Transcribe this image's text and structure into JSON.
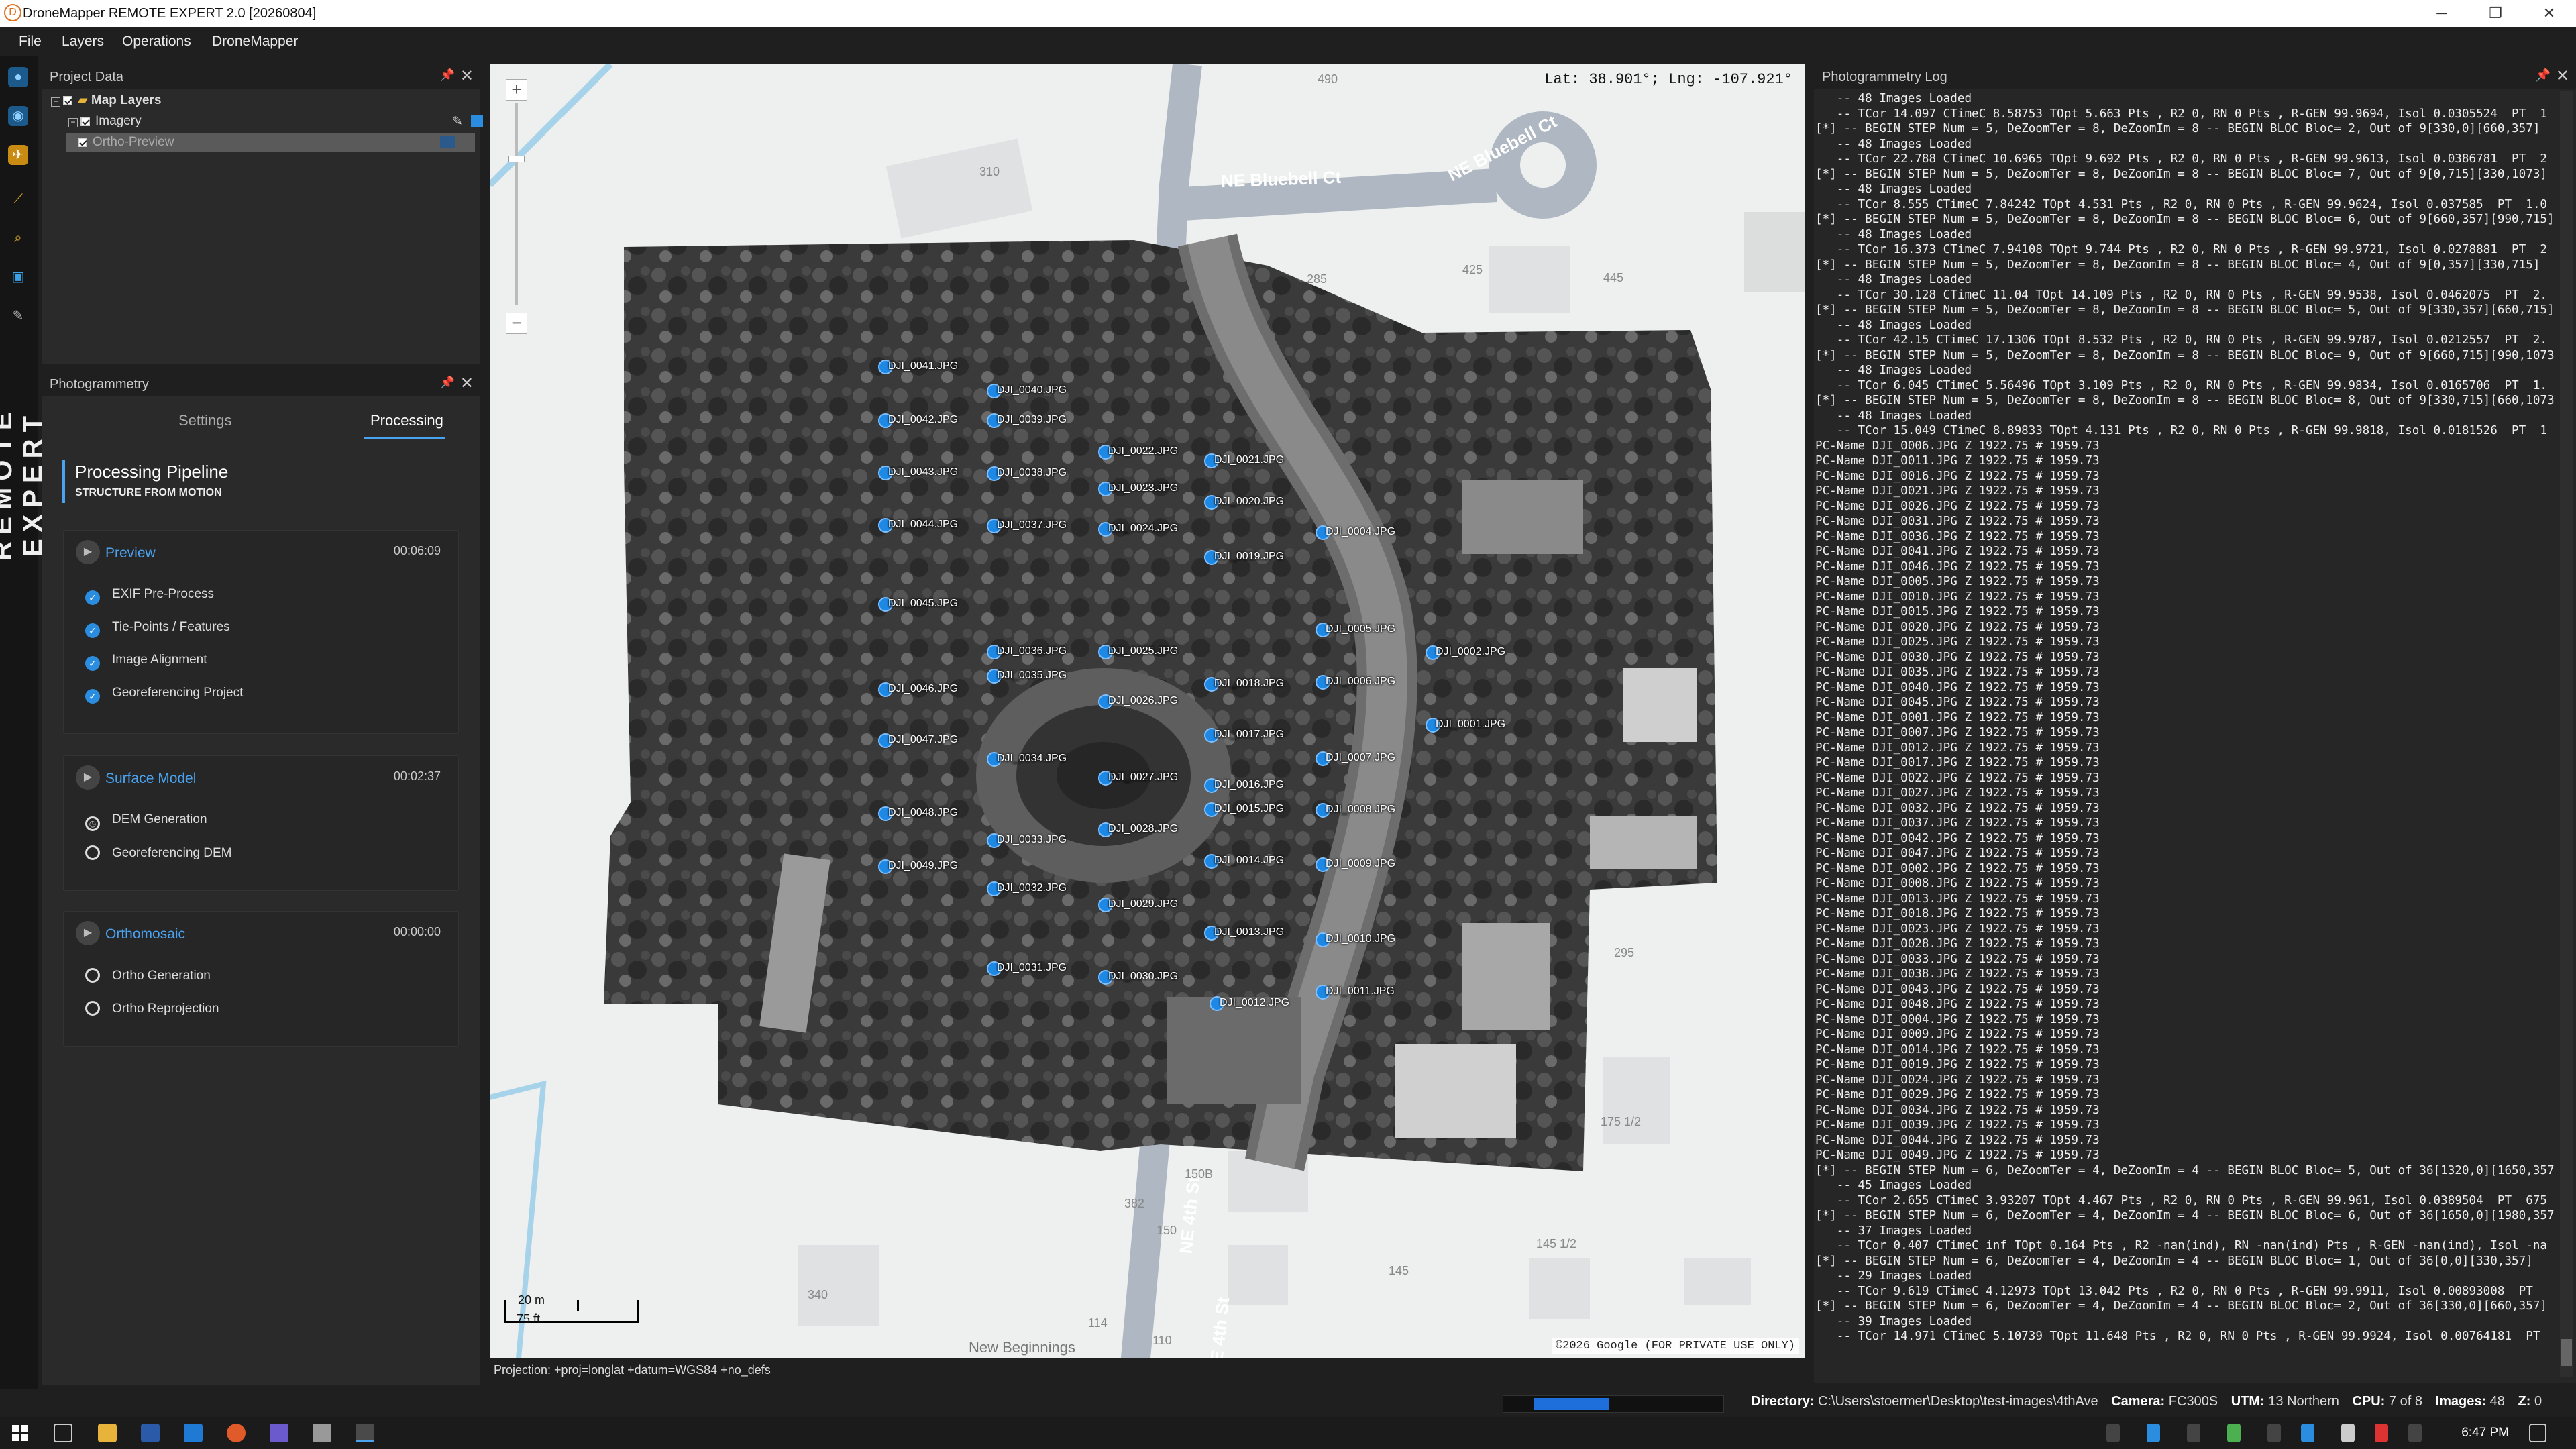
{
  "window": {
    "title": "DroneMapper REMOTE EXPERT 2.0 [20260804]",
    "minimize": "─",
    "restore": "❐",
    "close": "✕"
  },
  "menu": [
    "File",
    "Layers",
    "Operations",
    "DroneMapper"
  ],
  "rail": {
    "text": "REMOTE EXPERT"
  },
  "project_panel": {
    "title": "Project Data",
    "pin": "📌",
    "close": "✕",
    "tree": {
      "root": "Map Layers",
      "imagery": "Imagery",
      "ortho": "Ortho-Preview"
    }
  },
  "photogrammetry": {
    "title": "Photogrammetry",
    "tabs": [
      "Settings",
      "Processing"
    ],
    "active_tab": "Processing",
    "pipeline_title": "Processing Pipeline",
    "pipeline_sub": "STRUCTURE FROM MOTION",
    "stages": [
      {
        "name": "Preview",
        "time": "00:06:09",
        "steps": [
          {
            "label": "EXIF Pre-Process",
            "state": "done"
          },
          {
            "label": "Tie-Points / Features",
            "state": "done"
          },
          {
            "label": "Image Alignment",
            "state": "done"
          },
          {
            "label": "Georeferencing Project",
            "state": "done"
          }
        ]
      },
      {
        "name": "Surface Model",
        "time": "00:02:37",
        "steps": [
          {
            "label": "DEM Generation",
            "state": "run"
          },
          {
            "label": "Georeferencing DEM",
            "state": "todo"
          }
        ]
      },
      {
        "name": "Orthomosaic",
        "time": "00:00:00",
        "steps": [
          {
            "label": "Ortho Generation",
            "state": "todo"
          },
          {
            "label": "Ortho Reprojection",
            "state": "todo"
          }
        ]
      }
    ]
  },
  "map": {
    "coords": "Lat: 38.901°; Lng: -107.921°",
    "zoom_in": "+",
    "zoom_out": "−",
    "streets": [
      "NE Bluebell Ct",
      "NE Bluebell Ct",
      "NE 4th St",
      "NE 4th St"
    ],
    "lot_numbers": [
      "490",
      "310",
      "285",
      "425",
      "445",
      "295",
      "175 1/2",
      "150B",
      "382",
      "150",
      "145",
      "145 1/2",
      "340",
      "114",
      "110"
    ],
    "other_labels": [
      "New Beginnings"
    ],
    "scale_m": "20 m",
    "scale_ft": "75 ft",
    "copyright": "©2026 Google (FOR PRIVATE USE ONLY)",
    "projection": "Projection: +proj=longlat +datum=WGS84 +no_defs",
    "cameras": [
      {
        "l": "DJI_0041.JPG"
      },
      {
        "l": "DJI_0040.JPG"
      },
      {
        "l": "DJI_0042.JPG"
      },
      {
        "l": "DJI_0039.JPG"
      },
      {
        "l": "DJI_0022.JPG"
      },
      {
        "l": "DJI_0021.JPG"
      },
      {
        "l": "DJI_0043.JPG"
      },
      {
        "l": "DJI_0038.JPG"
      },
      {
        "l": "DJI_0023.JPG"
      },
      {
        "l": "DJI_0020.JPG"
      },
      {
        "l": "DJI_0044.JPG"
      },
      {
        "l": "DJI_0004.JPG"
      },
      {
        "l": "DJI_0037.JPG"
      },
      {
        "l": "DJI_0024.JPG"
      },
      {
        "l": "DJI_0019.JPG"
      },
      {
        "l": "DJI_0045.JPG"
      },
      {
        "l": "DJI_0005.JPG"
      },
      {
        "l": "DJI_0036.JPG"
      },
      {
        "l": "DJI_0025.JPG"
      },
      {
        "l": "DJI_0002.JPG"
      },
      {
        "l": "DJI_0035.JPG"
      },
      {
        "l": "DJI_0046.JPG"
      },
      {
        "l": "DJI_0018.JPG"
      },
      {
        "l": "DJI_0006.JPG"
      },
      {
        "l": "DJI_0026.JPG"
      },
      {
        "l": "DJI_0001.JPG"
      },
      {
        "l": "DJI_0047.JPG"
      },
      {
        "l": "DJI_0017.JPG"
      },
      {
        "l": "DJI_0034.JPG"
      },
      {
        "l": "DJI_0007.JPG"
      },
      {
        "l": "DJI_0027.JPG"
      },
      {
        "l": "DJI_0016.JPG"
      },
      {
        "l": "DJI_0048.JPG"
      },
      {
        "l": "DJI_0015.JPG"
      },
      {
        "l": "DJI_0008.JPG"
      },
      {
        "l": "DJI_0028.JPG"
      },
      {
        "l": "DJI_0033.JPG"
      },
      {
        "l": "DJI_0014.JPG"
      },
      {
        "l": "DJI_0049.JPG"
      },
      {
        "l": "DJI_0009.JPG"
      },
      {
        "l": "DJI_0032.JPG"
      },
      {
        "l": "DJI_0029.JPG"
      },
      {
        "l": "DJI_0013.JPG"
      },
      {
        "l": "DJI_0010.JPG"
      },
      {
        "l": "DJI_0031.JPG"
      },
      {
        "l": "DJI_0030.JPG"
      },
      {
        "l": "DJI_0011.JPG"
      },
      {
        "l": "DJI_0012.JPG"
      }
    ]
  },
  "log": {
    "title": "Photogrammetry Log",
    "lines": [
      "   -- 48 Images Loaded",
      "   -- TCor 14.097 CTimeC 8.58753 TOpt 5.663 Pts , R2 0, RN 0 Pts , R-GEN 99.9694, Isol 0.0305524  PT  1",
      "[*] -- BEGIN STEP Num = 5, DeZoomTer = 8, DeZoomIm = 8 -- BEGIN BLOC Bloc= 2, Out of 9[330,0][660,357]",
      "   -- 48 Images Loaded",
      "   -- TCor 22.788 CTimeC 10.6965 TOpt 9.692 Pts , R2 0, RN 0 Pts , R-GEN 99.9613, Isol 0.0386781  PT  2",
      "[*] -- BEGIN STEP Num = 5, DeZoomTer = 8, DeZoomIm = 8 -- BEGIN BLOC Bloc= 7, Out of 9[0,715][330,1073]",
      "   -- 48 Images Loaded",
      "   -- TCor 8.555 CTimeC 7.84242 TOpt 4.531 Pts , R2 0, RN 0 Pts , R-GEN 99.9624, Isol 0.037585  PT  1.0",
      "[*] -- BEGIN STEP Num = 5, DeZoomTer = 8, DeZoomIm = 8 -- BEGIN BLOC Bloc= 6, Out of 9[660,357][990,715]",
      "   -- 48 Images Loaded",
      "   -- TCor 16.373 CTimeC 7.94108 TOpt 9.744 Pts , R2 0, RN 0 Pts , R-GEN 99.9721, Isol 0.0278881  PT  2",
      "[*] -- BEGIN STEP Num = 5, DeZoomTer = 8, DeZoomIm = 8 -- BEGIN BLOC Bloc= 4, Out of 9[0,357][330,715]",
      "   -- 48 Images Loaded",
      "   -- TCor 30.128 CTimeC 11.04 TOpt 14.109 Pts , R2 0, RN 0 Pts , R-GEN 99.9538, Isol 0.0462075  PT  2.",
      "[*] -- BEGIN STEP Num = 5, DeZoomTer = 8, DeZoomIm = 8 -- BEGIN BLOC Bloc= 5, Out of 9[330,357][660,715]",
      "   -- 48 Images Loaded",
      "   -- TCor 42.15 CTimeC 17.1306 TOpt 8.532 Pts , R2 0, RN 0 Pts , R-GEN 99.9787, Isol 0.0212557  PT  2.",
      "[*] -- BEGIN STEP Num = 5, DeZoomTer = 8, DeZoomIm = 8 -- BEGIN BLOC Bloc= 9, Out of 9[660,715][990,1073",
      "   -- 48 Images Loaded",
      "   -- TCor 6.045 CTimeC 5.56496 TOpt 3.109 Pts , R2 0, RN 0 Pts , R-GEN 99.9834, Isol 0.0165706  PT  1.",
      "[*] -- BEGIN STEP Num = 5, DeZoomTer = 8, DeZoomIm = 8 -- BEGIN BLOC Bloc= 8, Out of 9[330,715][660,1073",
      "   -- 48 Images Loaded",
      "   -- TCor 15.049 CTimeC 8.89833 TOpt 4.131 Pts , R2 0, RN 0 Pts , R-GEN 99.9818, Isol 0.0181526  PT  1",
      "PC-Name DJI_0006.JPG Z 1922.75 # 1959.73",
      "PC-Name DJI_0011.JPG Z 1922.75 # 1959.73",
      "PC-Name DJI_0016.JPG Z 1922.75 # 1959.73",
      "PC-Name DJI_0021.JPG Z 1922.75 # 1959.73",
      "PC-Name DJI_0026.JPG Z 1922.75 # 1959.73",
      "PC-Name DJI_0031.JPG Z 1922.75 # 1959.73",
      "PC-Name DJI_0036.JPG Z 1922.75 # 1959.73",
      "PC-Name DJI_0041.JPG Z 1922.75 # 1959.73",
      "PC-Name DJI_0046.JPG Z 1922.75 # 1959.73",
      "PC-Name DJI_0005.JPG Z 1922.75 # 1959.73",
      "PC-Name DJI_0010.JPG Z 1922.75 # 1959.73",
      "PC-Name DJI_0015.JPG Z 1922.75 # 1959.73",
      "PC-Name DJI_0020.JPG Z 1922.75 # 1959.73",
      "PC-Name DJI_0025.JPG Z 1922.75 # 1959.73",
      "PC-Name DJI_0030.JPG Z 1922.75 # 1959.73",
      "PC-Name DJI_0035.JPG Z 1922.75 # 1959.73",
      "PC-Name DJI_0040.JPG Z 1922.75 # 1959.73",
      "PC-Name DJI_0045.JPG Z 1922.75 # 1959.73",
      "PC-Name DJI_0001.JPG Z 1922.75 # 1959.73",
      "PC-Name DJI_0007.JPG Z 1922.75 # 1959.73",
      "PC-Name DJI_0012.JPG Z 1922.75 # 1959.73",
      "PC-Name DJI_0017.JPG Z 1922.75 # 1959.73",
      "PC-Name DJI_0022.JPG Z 1922.75 # 1959.73",
      "PC-Name DJI_0027.JPG Z 1922.75 # 1959.73",
      "PC-Name DJI_0032.JPG Z 1922.75 # 1959.73",
      "PC-Name DJI_0037.JPG Z 1922.75 # 1959.73",
      "PC-Name DJI_0042.JPG Z 1922.75 # 1959.73",
      "PC-Name DJI_0047.JPG Z 1922.75 # 1959.73",
      "PC-Name DJI_0002.JPG Z 1922.75 # 1959.73",
      "PC-Name DJI_0008.JPG Z 1922.75 # 1959.73",
      "PC-Name DJI_0013.JPG Z 1922.75 # 1959.73",
      "PC-Name DJI_0018.JPG Z 1922.75 # 1959.73",
      "PC-Name DJI_0023.JPG Z 1922.75 # 1959.73",
      "PC-Name DJI_0028.JPG Z 1922.75 # 1959.73",
      "PC-Name DJI_0033.JPG Z 1922.75 # 1959.73",
      "PC-Name DJI_0038.JPG Z 1922.75 # 1959.73",
      "PC-Name DJI_0043.JPG Z 1922.75 # 1959.73",
      "PC-Name DJI_0048.JPG Z 1922.75 # 1959.73",
      "PC-Name DJI_0004.JPG Z 1922.75 # 1959.73",
      "PC-Name DJI_0009.JPG Z 1922.75 # 1959.73",
      "PC-Name DJI_0014.JPG Z 1922.75 # 1959.73",
      "PC-Name DJI_0019.JPG Z 1922.75 # 1959.73",
      "PC-Name DJI_0024.JPG Z 1922.75 # 1959.73",
      "PC-Name DJI_0029.JPG Z 1922.75 # 1959.73",
      "PC-Name DJI_0034.JPG Z 1922.75 # 1959.73",
      "PC-Name DJI_0039.JPG Z 1922.75 # 1959.73",
      "PC-Name DJI_0044.JPG Z 1922.75 # 1959.73",
      "PC-Name DJI_0049.JPG Z 1922.75 # 1959.73",
      "[*] -- BEGIN STEP Num = 6, DeZoomTer = 4, DeZoomIm = 4 -- BEGIN BLOC Bloc= 5, Out of 36[1320,0][1650,357",
      "   -- 45 Images Loaded",
      "   -- TCor 2.655 CTimeC 3.93207 TOpt 4.467 Pts , R2 0, RN 0 Pts , R-GEN 99.961, Isol 0.0389504  PT  675",
      "[*] -- BEGIN STEP Num = 6, DeZoomTer = 4, DeZoomIm = 4 -- BEGIN BLOC Bloc= 6, Out of 36[1650,0][1980,357",
      "   -- 37 Images Loaded",
      "   -- TCor 0.407 CTimeC inf TOpt 0.164 Pts , R2 -nan(ind), RN -nan(ind) Pts , R-GEN -nan(ind), Isol -na",
      "[*] -- BEGIN STEP Num = 6, DeZoomTer = 4, DeZoomIm = 4 -- BEGIN BLOC Bloc= 1, Out of 36[0,0][330,357]",
      "   -- 29 Images Loaded",
      "   -- TCor 9.619 CTimeC 4.12973 TOpt 13.042 Pts , R2 0, RN 0 Pts , R-GEN 99.9911, Isol 0.00893008  PT",
      "[*] -- BEGIN STEP Num = 6, DeZoomTer = 4, DeZoomIm = 4 -- BEGIN BLOC Bloc= 2, Out of 36[330,0][660,357]",
      "   -- 39 Images Loaded",
      "   -- TCor 14.971 CTimeC 5.10739 TOpt 11.648 Pts , R2 0, RN 0 Pts , R-GEN 99.9924, Isol 0.00764181  PT"
    ]
  },
  "status": {
    "progress": 0.34,
    "directory_label": "Directory:",
    "directory": "C:\\Users\\stoermer\\Desktop\\test-images\\4thAve",
    "camera_label": "Camera:",
    "camera": "FC300S",
    "utm_label": "UTM:",
    "utm": "13 Northern",
    "cpu_label": "CPU:",
    "cpu": "7 of 8",
    "images_label": "Images:",
    "images": "48",
    "z_label": "Z:",
    "z": "0"
  },
  "taskbar": {
    "clock": "6:47 PM"
  },
  "colors": {
    "accent": "#4aa3f0",
    "camera_dot": "#1e88e5",
    "bg": "#1f1f1f"
  }
}
